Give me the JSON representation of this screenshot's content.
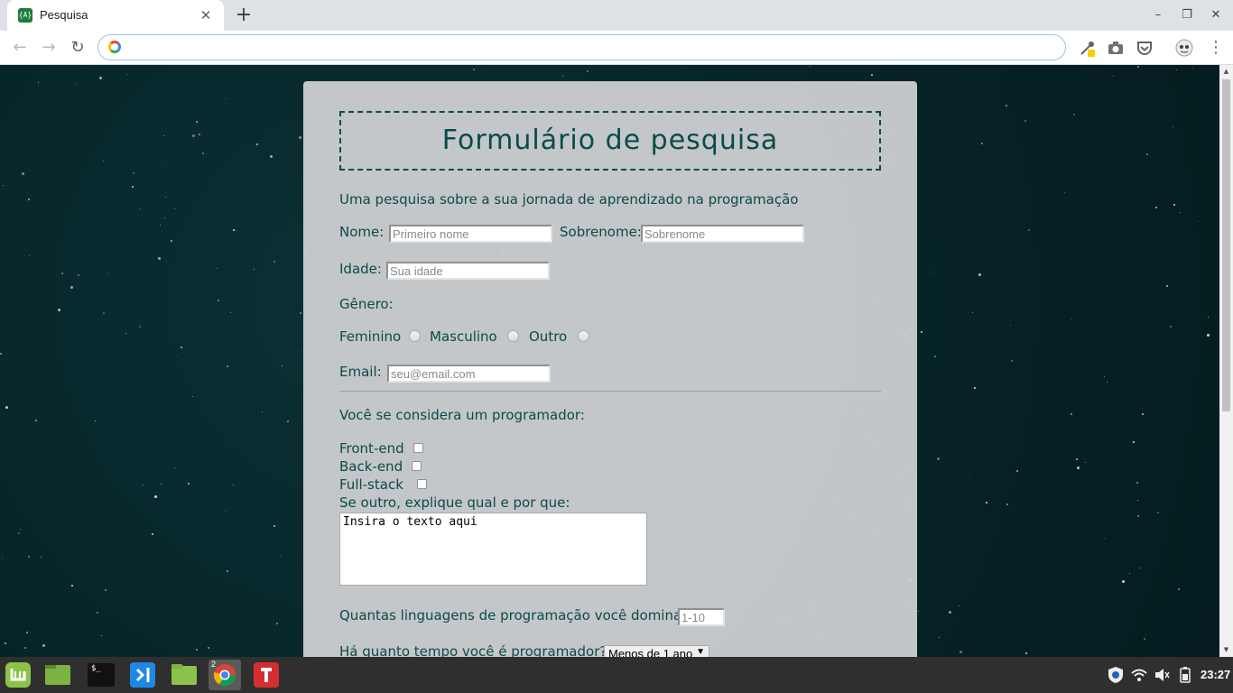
{
  "browser": {
    "tab_title": "Pesquisa",
    "tab_favicon_text": "{A}",
    "tab_close_glyph": "✕",
    "new_tab_glyph": "+",
    "url": "",
    "window_controls": [
      "–",
      "❐",
      "✕"
    ],
    "nav": {
      "back": "←",
      "forward": "→",
      "reload": "↻"
    },
    "extensions": [
      "eyedropper-icon",
      "camera-icon",
      "pocket-icon",
      "profile-icon"
    ]
  },
  "form": {
    "title": "Formulário de pesquisa",
    "description": "Uma pesquisa sobre a sua jornada de aprendizado na programação",
    "name_label": "Nome:",
    "name_placeholder": "Primeiro nome",
    "surname_label": "Sobrenome:",
    "surname_placeholder": "Sobrenome",
    "age_label": "Idade:",
    "age_placeholder": "Sua idade",
    "gender_label": "Gênero:",
    "gender_options": [
      "Feminino",
      "Masculino",
      "Outro"
    ],
    "email_label": "Email:",
    "email_placeholder": "seu@email.com",
    "programmer_label": "Você se considera um programador:",
    "programmer_options": [
      "Front-end",
      "Back-end",
      "Full-stack"
    ],
    "other_label": "Se outro, explique qual e por que:",
    "other_text": "Insira o texto aqui",
    "languages_label": "Quantas linguagens de programação você domina?",
    "languages_placeholder": "1-10",
    "time_label": "Há quanto tempo você é programador?",
    "time_selected": "Menos de 1 ano"
  },
  "taskbar": {
    "apps": [
      "mint-menu-icon",
      "files-icon",
      "terminal-icon",
      "vscode-icon",
      "folder-icon",
      "chrome-icon",
      "gitkraken-icon"
    ],
    "chrome_badge": "2",
    "terminal_text": "$_",
    "clock": "23:27",
    "tray": [
      "shield-icon",
      "wifi-icon",
      "volume-icon",
      "battery-icon"
    ]
  },
  "colors": {
    "page_bg": "#062326",
    "accent_text": "#0b4a4a",
    "card_bg": "#cdd0d2"
  }
}
